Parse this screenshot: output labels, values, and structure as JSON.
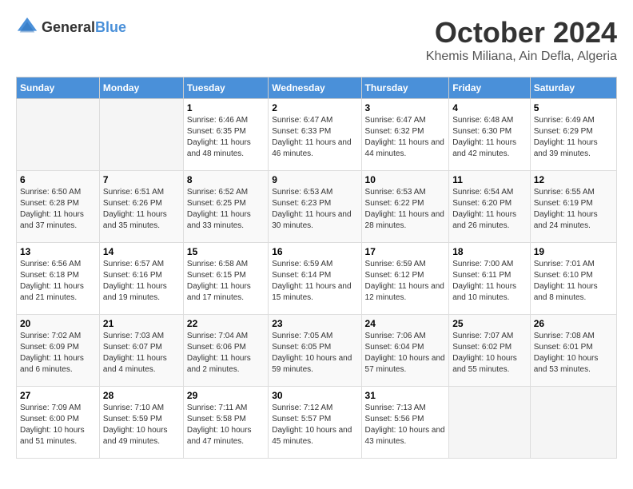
{
  "header": {
    "logo_general": "General",
    "logo_blue": "Blue",
    "month": "October 2024",
    "location": "Khemis Miliana, Ain Defla, Algeria"
  },
  "days_of_week": [
    "Sunday",
    "Monday",
    "Tuesday",
    "Wednesday",
    "Thursday",
    "Friday",
    "Saturday"
  ],
  "weeks": [
    [
      {
        "day": "",
        "sunrise": "",
        "sunset": "",
        "daylight": ""
      },
      {
        "day": "",
        "sunrise": "",
        "sunset": "",
        "daylight": ""
      },
      {
        "day": "1",
        "sunrise": "Sunrise: 6:46 AM",
        "sunset": "Sunset: 6:35 PM",
        "daylight": "Daylight: 11 hours and 48 minutes."
      },
      {
        "day": "2",
        "sunrise": "Sunrise: 6:47 AM",
        "sunset": "Sunset: 6:33 PM",
        "daylight": "Daylight: 11 hours and 46 minutes."
      },
      {
        "day": "3",
        "sunrise": "Sunrise: 6:47 AM",
        "sunset": "Sunset: 6:32 PM",
        "daylight": "Daylight: 11 hours and 44 minutes."
      },
      {
        "day": "4",
        "sunrise": "Sunrise: 6:48 AM",
        "sunset": "Sunset: 6:30 PM",
        "daylight": "Daylight: 11 hours and 42 minutes."
      },
      {
        "day": "5",
        "sunrise": "Sunrise: 6:49 AM",
        "sunset": "Sunset: 6:29 PM",
        "daylight": "Daylight: 11 hours and 39 minutes."
      }
    ],
    [
      {
        "day": "6",
        "sunrise": "Sunrise: 6:50 AM",
        "sunset": "Sunset: 6:28 PM",
        "daylight": "Daylight: 11 hours and 37 minutes."
      },
      {
        "day": "7",
        "sunrise": "Sunrise: 6:51 AM",
        "sunset": "Sunset: 6:26 PM",
        "daylight": "Daylight: 11 hours and 35 minutes."
      },
      {
        "day": "8",
        "sunrise": "Sunrise: 6:52 AM",
        "sunset": "Sunset: 6:25 PM",
        "daylight": "Daylight: 11 hours and 33 minutes."
      },
      {
        "day": "9",
        "sunrise": "Sunrise: 6:53 AM",
        "sunset": "Sunset: 6:23 PM",
        "daylight": "Daylight: 11 hours and 30 minutes."
      },
      {
        "day": "10",
        "sunrise": "Sunrise: 6:53 AM",
        "sunset": "Sunset: 6:22 PM",
        "daylight": "Daylight: 11 hours and 28 minutes."
      },
      {
        "day": "11",
        "sunrise": "Sunrise: 6:54 AM",
        "sunset": "Sunset: 6:20 PM",
        "daylight": "Daylight: 11 hours and 26 minutes."
      },
      {
        "day": "12",
        "sunrise": "Sunrise: 6:55 AM",
        "sunset": "Sunset: 6:19 PM",
        "daylight": "Daylight: 11 hours and 24 minutes."
      }
    ],
    [
      {
        "day": "13",
        "sunrise": "Sunrise: 6:56 AM",
        "sunset": "Sunset: 6:18 PM",
        "daylight": "Daylight: 11 hours and 21 minutes."
      },
      {
        "day": "14",
        "sunrise": "Sunrise: 6:57 AM",
        "sunset": "Sunset: 6:16 PM",
        "daylight": "Daylight: 11 hours and 19 minutes."
      },
      {
        "day": "15",
        "sunrise": "Sunrise: 6:58 AM",
        "sunset": "Sunset: 6:15 PM",
        "daylight": "Daylight: 11 hours and 17 minutes."
      },
      {
        "day": "16",
        "sunrise": "Sunrise: 6:59 AM",
        "sunset": "Sunset: 6:14 PM",
        "daylight": "Daylight: 11 hours and 15 minutes."
      },
      {
        "day": "17",
        "sunrise": "Sunrise: 6:59 AM",
        "sunset": "Sunset: 6:12 PM",
        "daylight": "Daylight: 11 hours and 12 minutes."
      },
      {
        "day": "18",
        "sunrise": "Sunrise: 7:00 AM",
        "sunset": "Sunset: 6:11 PM",
        "daylight": "Daylight: 11 hours and 10 minutes."
      },
      {
        "day": "19",
        "sunrise": "Sunrise: 7:01 AM",
        "sunset": "Sunset: 6:10 PM",
        "daylight": "Daylight: 11 hours and 8 minutes."
      }
    ],
    [
      {
        "day": "20",
        "sunrise": "Sunrise: 7:02 AM",
        "sunset": "Sunset: 6:09 PM",
        "daylight": "Daylight: 11 hours and 6 minutes."
      },
      {
        "day": "21",
        "sunrise": "Sunrise: 7:03 AM",
        "sunset": "Sunset: 6:07 PM",
        "daylight": "Daylight: 11 hours and 4 minutes."
      },
      {
        "day": "22",
        "sunrise": "Sunrise: 7:04 AM",
        "sunset": "Sunset: 6:06 PM",
        "daylight": "Daylight: 11 hours and 2 minutes."
      },
      {
        "day": "23",
        "sunrise": "Sunrise: 7:05 AM",
        "sunset": "Sunset: 6:05 PM",
        "daylight": "Daylight: 10 hours and 59 minutes."
      },
      {
        "day": "24",
        "sunrise": "Sunrise: 7:06 AM",
        "sunset": "Sunset: 6:04 PM",
        "daylight": "Daylight: 10 hours and 57 minutes."
      },
      {
        "day": "25",
        "sunrise": "Sunrise: 7:07 AM",
        "sunset": "Sunset: 6:02 PM",
        "daylight": "Daylight: 10 hours and 55 minutes."
      },
      {
        "day": "26",
        "sunrise": "Sunrise: 7:08 AM",
        "sunset": "Sunset: 6:01 PM",
        "daylight": "Daylight: 10 hours and 53 minutes."
      }
    ],
    [
      {
        "day": "27",
        "sunrise": "Sunrise: 7:09 AM",
        "sunset": "Sunset: 6:00 PM",
        "daylight": "Daylight: 10 hours and 51 minutes."
      },
      {
        "day": "28",
        "sunrise": "Sunrise: 7:10 AM",
        "sunset": "Sunset: 5:59 PM",
        "daylight": "Daylight: 10 hours and 49 minutes."
      },
      {
        "day": "29",
        "sunrise": "Sunrise: 7:11 AM",
        "sunset": "Sunset: 5:58 PM",
        "daylight": "Daylight: 10 hours and 47 minutes."
      },
      {
        "day": "30",
        "sunrise": "Sunrise: 7:12 AM",
        "sunset": "Sunset: 5:57 PM",
        "daylight": "Daylight: 10 hours and 45 minutes."
      },
      {
        "day": "31",
        "sunrise": "Sunrise: 7:13 AM",
        "sunset": "Sunset: 5:56 PM",
        "daylight": "Daylight: 10 hours and 43 minutes."
      },
      {
        "day": "",
        "sunrise": "",
        "sunset": "",
        "daylight": ""
      },
      {
        "day": "",
        "sunrise": "",
        "sunset": "",
        "daylight": ""
      }
    ]
  ]
}
